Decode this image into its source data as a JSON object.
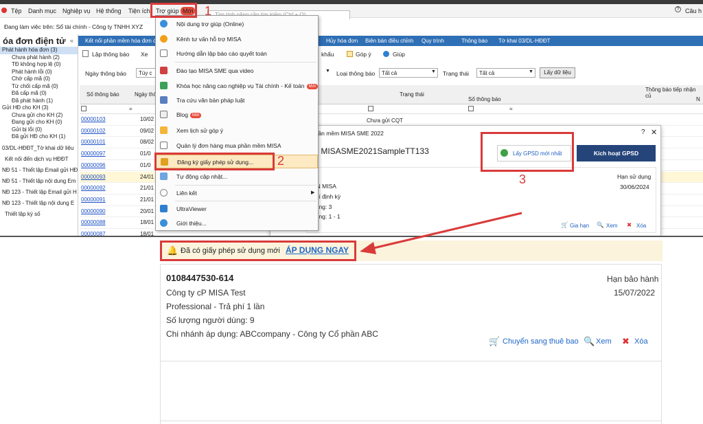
{
  "menubar": {
    "items": [
      "Tệp",
      "Danh mục",
      "Nghiệp vụ",
      "Hệ thống",
      "Tiện ích",
      "Trợ giúp"
    ],
    "new_badge": "Mới",
    "search_placeholder": "Tìm tính năng cần tìm kiếm (Ctrl + Q)",
    "right_label": "Câu h"
  },
  "workbar": {
    "text": "Đang làm việc trên: Sổ tài chính - Công ty TNHH XYZ"
  },
  "left": {
    "title": "óa đơn điện tử",
    "collapse": "«",
    "tree": [
      "Phát hành hóa đơn (3)",
      "Chưa phát hành (2)",
      "TĐ không hợp lệ (0)",
      "Phát hành lỗi (0)",
      "Chờ cấp mã (0)",
      "Từ chối cấp mã (0)",
      "Đã cấp mã (0)",
      "Đã phát hành (1)",
      "Gửi HĐ cho KH (3)",
      "Chưa gửi cho KH (2)",
      "Đang gửi cho KH (0)",
      "Gửi bị lỗi (0)",
      "Đã gửi HĐ cho KH (1)"
    ],
    "links": [
      "03/DL-HĐĐT_Tờ khai dữ liệu",
      "Kết nối đến dịch vụ HĐĐT",
      "NĐ 51 - Thiết lập Email gửi HĐ",
      "NĐ 51 - Thiết lập nội dung Em",
      "NĐ 123 - Thiết lập Email gửi H",
      "NĐ 123 - Thiết lập nội dung E",
      "Thiết lập ký số"
    ]
  },
  "bluebar": [
    "Kết nối phần mềm hóa đơn đ",
    "Hủy hóa đơn",
    "Biên bản điều chỉnh",
    "Quy trình",
    "Thông báo",
    "Tờ khai 03/DL-HĐĐT"
  ],
  "toolbar": {
    "create": "Lập thông báo",
    "x": "Xe",
    "export": "khẩu",
    "feedback": "Góp ý",
    "help": "Giúp"
  },
  "filter": {
    "date_label": "Ngày thông báo",
    "date_value": "Tùy c",
    "type_label": "Loại thông báo",
    "type_value": "Tất cả",
    "status_label": "Trạng thái",
    "status_value": "Tất cả",
    "load_button": "Lấy dữ liệu"
  },
  "table": {
    "col_no": "Số thông báo",
    "col_date": "Ngày thô",
    "col_status": "Trạng thái",
    "col_receive": "Thông báo tiếp nhận củ",
    "col_sub_no": "Số thông báo",
    "col_n": "N",
    "eq": "=",
    "status_first": "Chưa gửi CQT",
    "rows": [
      {
        "no": "00000103",
        "date": "10/02"
      },
      {
        "no": "00000102",
        "date": "09/02"
      },
      {
        "no": "00000101",
        "date": "08/02"
      },
      {
        "no": "00000097",
        "date": "01/0"
      },
      {
        "no": "00000096",
        "date": "01/0"
      },
      {
        "no": "00000093",
        "date": "24/01"
      },
      {
        "no": "00000092",
        "date": "21/01"
      },
      {
        "no": "00000091",
        "date": "21/01"
      },
      {
        "no": "00000090",
        "date": "20/01"
      },
      {
        "no": "00000088",
        "date": "18/01"
      },
      {
        "no": "00000087",
        "date": "18/01"
      }
    ]
  },
  "help_menu": [
    "Nội dung trợ giúp (Online)",
    "Kênh tư vấn hỗ trợ MISA",
    "Hướng dẫn lập báo cáo quyết toán",
    "Đào tạo MISA SME qua video",
    "Khóa học nâng cao nghiệp vụ Tài chính - Kế toán",
    "Tra cứu văn bản pháp luật",
    "Blog",
    "Xem lịch sử góp ý",
    "Quản lý đơn hàng mua phần mềm MISA",
    "Đăng ký giấy phép sử dụng...",
    "Tự động cập nhật...",
    "Liên kết",
    "UltraViewer",
    "Giới thiệu..."
  ],
  "dialog": {
    "title": "phần mềm MISA SME 2022",
    "product": "n: MISASME2021SampleTT133",
    "get_license": "Lấy GPSD mới nhất",
    "activate": "Kích hoạt GPSD",
    "help": "?",
    "close": "✕",
    "expiry_label": "Hạn sử dụng",
    "expiry": "30/06/2024",
    "lines": [
      "ẤN MISA",
      "phí định kỳ",
      "dùng: 3",
      "dụng: 1 - 1"
    ],
    "renew": "Gia hạn",
    "view": "Xem",
    "delete": "Xóa"
  },
  "annotations": [
    "1",
    "2",
    "3"
  ],
  "notice": {
    "text": "Đã có giấy phép sử dụng mới",
    "link": "ÁP DỤNG NGAY"
  },
  "license_card": {
    "key": "0108447530-614",
    "company": "Công ty cP MISA Test",
    "edition": "Professional - Trả phí 1 lần",
    "users": "Số lượng người dùng: 9",
    "branch": "Chi nhánh áp dụng: ABCcompany - Công ty Cổ phần ABC",
    "warranty_label": "Hạn bảo hành",
    "warranty_date": "15/07/2022",
    "switch": "Chuyển sang thuê bao",
    "view": "Xem",
    "delete": "Xóa"
  }
}
